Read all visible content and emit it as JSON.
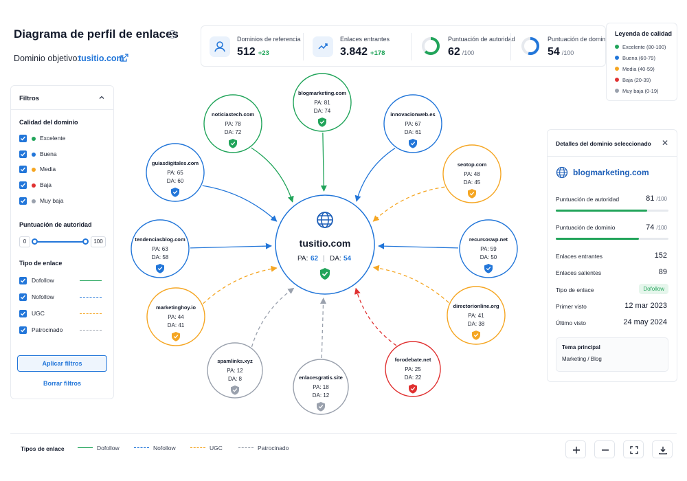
{
  "header": {
    "title": "Diagrama de perfil de enlaces",
    "target_label": "Dominio objetivo:",
    "target_domain": "tusitio.com"
  },
  "stats": [
    {
      "title": "Dominios de referencia",
      "value": "512",
      "delta": "+23",
      "icon": "user-icon"
    },
    {
      "title": "Enlaces entrantes",
      "value": "3.842",
      "delta": "+178",
      "icon": "link-icon"
    },
    {
      "title": "Puntuación de autoridad",
      "value": "62",
      "max": "/100",
      "progress": 62,
      "color": "#21a45a"
    },
    {
      "title": "Puntuación de dominio",
      "value": "54",
      "max": "/100",
      "progress": 54,
      "color": "#2276d9"
    }
  ],
  "legend": {
    "title": "Leyenda de calidad",
    "items": [
      {
        "label": "Excelente (80-100)",
        "color": "#21a45a"
      },
      {
        "label": "Buena (60-79)",
        "color": "#2276d9"
      },
      {
        "label": "Media (40-59)",
        "color": "#f5a623"
      },
      {
        "label": "Baja (20-39)",
        "color": "#e03131"
      },
      {
        "label": "Muy baja (0-19)",
        "color": "#9aa1ad"
      }
    ]
  },
  "filters": {
    "title": "Filtros",
    "quality_title": "Calidad del dominio",
    "quality": [
      {
        "label": "Excelente",
        "color": "#21a45a",
        "checked": true
      },
      {
        "label": "Buena",
        "color": "#2276d9",
        "checked": true
      },
      {
        "label": "Media",
        "color": "#f5a623",
        "checked": true
      },
      {
        "label": "Baja",
        "color": "#e03131",
        "checked": true
      },
      {
        "label": "Muy baja",
        "color": "#9aa1ad",
        "checked": true
      }
    ],
    "authority_title": "Puntuación de autoridad",
    "slider_min": "0",
    "slider_max": "100",
    "link_type_title": "Tipo de enlace",
    "link_types": [
      {
        "label": "Dofollow",
        "color": "#21a45a",
        "style": "solid",
        "checked": true
      },
      {
        "label": "Nofollow",
        "color": "#2276d9",
        "style": "dashed",
        "checked": true
      },
      {
        "label": "UGC",
        "color": "#f5a623",
        "style": "dashed",
        "checked": true
      },
      {
        "label": "Patrocinado",
        "color": "#9aa1ad",
        "style": "dashed",
        "checked": true
      }
    ],
    "apply_label": "Aplicar filtros",
    "clear_label": "Borrar filtros"
  },
  "graph": {
    "center": {
      "domain": "tusitio.com",
      "pa_label": "PA:",
      "pa": "62",
      "da_label": "DA:",
      "da": "54",
      "sep": "|"
    },
    "nodes": [
      {
        "domain": "blogmarketing.com",
        "pa": "81",
        "da": "74",
        "quality": "excelente",
        "link": "dofollow"
      },
      {
        "domain": "noticiastech.com",
        "pa": "78",
        "da": "72",
        "quality": "excelente",
        "link": "dofollow"
      },
      {
        "domain": "innovacionweb.es",
        "pa": "67",
        "da": "61",
        "quality": "buena",
        "link": "dofollow"
      },
      {
        "domain": "guiasdigitales.com",
        "pa": "65",
        "da": "60",
        "quality": "buena",
        "link": "dofollow"
      },
      {
        "domain": "seotop.com",
        "pa": "48",
        "da": "45",
        "quality": "media",
        "link": "nofollow"
      },
      {
        "domain": "tendenciasblog.com",
        "pa": "63",
        "da": "58",
        "quality": "buena",
        "link": "dofollow"
      },
      {
        "domain": "recursoswp.net",
        "pa": "59",
        "da": "50",
        "quality": "buena",
        "link": "dofollow"
      },
      {
        "domain": "marketinghoy.io",
        "pa": "44",
        "da": "41",
        "quality": "media",
        "link": "ugc"
      },
      {
        "domain": "directorionline.org",
        "pa": "41",
        "da": "38",
        "quality": "media",
        "link": "ugc"
      },
      {
        "domain": "spamlinks.xyz",
        "pa": "12",
        "da": "8",
        "quality": "muy-baja",
        "link": "patrocinado"
      },
      {
        "domain": "enlacesgratis.site",
        "pa": "18",
        "da": "12",
        "quality": "muy-baja",
        "link": "patrocinado"
      },
      {
        "domain": "forodebate.net",
        "pa": "25",
        "da": "22",
        "quality": "baja",
        "link": "baja"
      }
    ]
  },
  "details": {
    "title": "Detalles del dominio seleccionado",
    "domain": "blogmarketing.com",
    "authority_label": "Puntuación de autoridad",
    "authority_value": "81",
    "authority_progress": 81,
    "domain_score_label": "Puntuación de dominio",
    "domain_score_value": "74",
    "domain_score_progress": 74,
    "max": "/100",
    "incoming_label": "Enlaces entrantes",
    "incoming_value": "152",
    "outgoing_label": "Enlaces salientes",
    "outgoing_value": "89",
    "link_type_label": "Tipo de enlace",
    "link_type_value": "Dofollow",
    "first_seen_label": "Primer visto",
    "first_seen_value": "12 mar 2023",
    "last_seen_label": "Último visto",
    "last_seen_value": "24 may 2024",
    "topic_title": "Tema principal",
    "topic_value": "Marketing / Blog"
  },
  "bottom": {
    "title": "Tipos de enlace",
    "items": [
      {
        "label": "Dofollow",
        "color": "#21a45a",
        "style": "solid"
      },
      {
        "label": "Nofollow",
        "color": "#2276d9",
        "style": "dashed"
      },
      {
        "label": "UGC",
        "color": "#f5a623",
        "style": "dashed"
      },
      {
        "label": "Patrocinado",
        "color": "#9aa1ad",
        "style": "dashed"
      }
    ]
  },
  "colors": {
    "excelente": "#21a45a",
    "buena": "#2276d9",
    "media": "#f5a623",
    "baja": "#e03131",
    "muy-baja": "#9aa1ad"
  }
}
